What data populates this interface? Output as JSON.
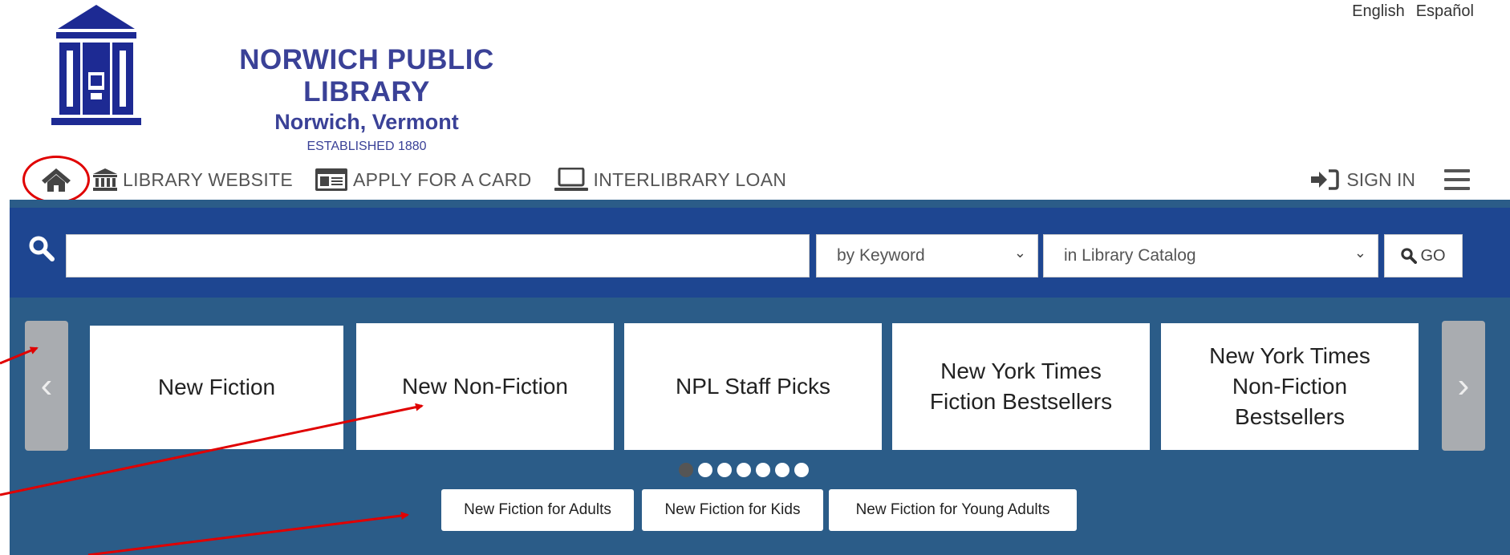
{
  "header": {
    "lang_english": "English",
    "lang_spanish": "Español",
    "brand_title": "NORWICH PUBLIC LIBRARY",
    "brand_subtitle": "Norwich, Vermont",
    "brand_established": "ESTABLISHED 1880",
    "logo_icon": "library-building-icon"
  },
  "nav": {
    "home_icon": "home-icon",
    "library_website": "LIBRARY WEBSITE",
    "apply_card": "APPLY FOR A CARD",
    "interlibrary_loan": "INTERLIBRARY LOAN",
    "sign_in": "SIGN IN",
    "menu_icon": "hamburger-menu-icon"
  },
  "search": {
    "query": "",
    "type_selected": "by Keyword",
    "scope_selected": "in Library Catalog",
    "go_label": "GO"
  },
  "carousel": {
    "cards": [
      [
        "New Fiction"
      ],
      [
        "New Non-Fiction"
      ],
      [
        "NPL Staff Picks"
      ],
      [
        "New York Times",
        "Fiction Bestsellers"
      ],
      [
        "New York Times",
        "Non-Fiction",
        "Bestsellers"
      ]
    ],
    "dots_count": 7,
    "active_dot": 0,
    "prev_glyph": "‹",
    "next_glyph": "›"
  },
  "tabs": [
    "New Fiction for Adults",
    "New Fiction for Kids",
    "New Fiction for Young Adults"
  ],
  "colors": {
    "brand": "#3a4197",
    "search_band": "#1e4691",
    "carousel_band": "#2b5c88",
    "annotation": "#e00000"
  }
}
